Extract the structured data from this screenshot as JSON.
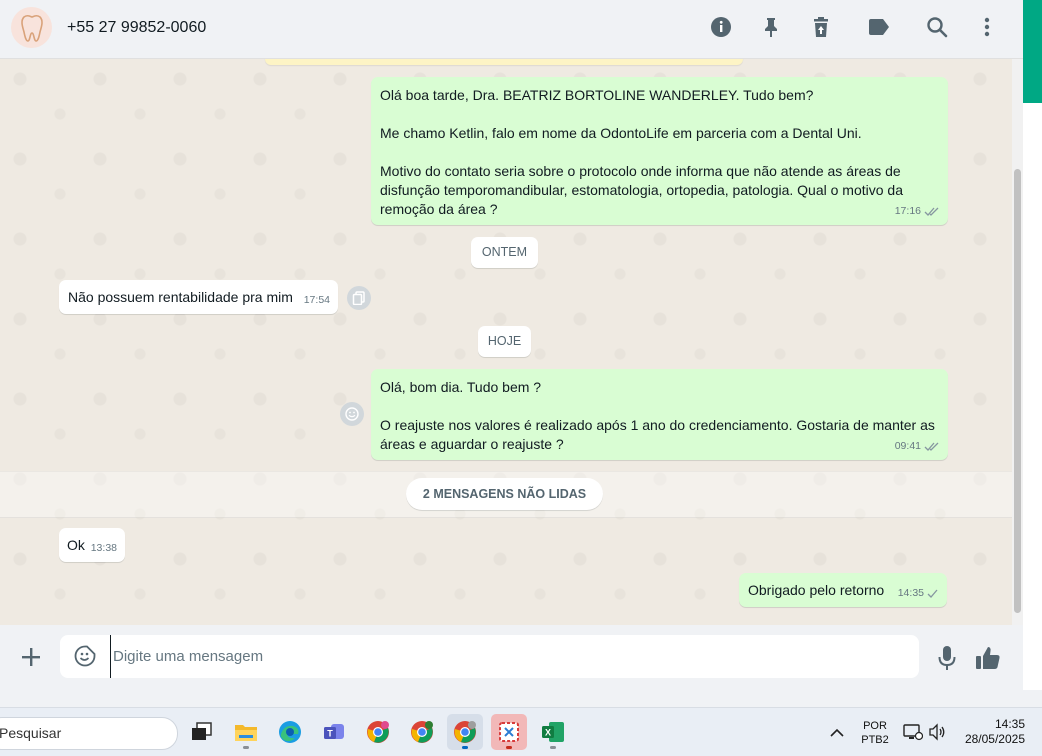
{
  "header": {
    "contact_name": "+55 27 99852-0060",
    "icons": [
      "info-icon",
      "pin-icon",
      "delete-icon",
      "label-icon",
      "search-icon",
      "menu-icon"
    ]
  },
  "messages": [
    {
      "direction": "out",
      "text": "Olá boa tarde, Dra. BEATRIZ BORTOLINE WANDERLEY. Tudo bem?\n\nMe chamo Ketlin, falo em nome da OdontoLife em parceria com a Dental Uni.\n\nMotivo do contato seria sobre o protocolo onde informa que não atende as áreas de\ndisfunção temporomandibular, estomatologia, ortopedia, patologia. Qual o motivo da\nremoção da área ?",
      "time": "17:16",
      "status": "read"
    },
    {
      "direction": "in",
      "text": "Não possuem rentabilidade pra mim",
      "time": "17:54"
    },
    {
      "direction": "out",
      "text": "Olá, bom dia. Tudo bem ?\n\nO reajuste nos valores é realizado após 1 ano do credenciamento. Gostaria de manter as\náreas e aguardar o reajuste ?",
      "time": "09:41",
      "status": "read"
    },
    {
      "direction": "in",
      "text": "Ok",
      "time": "13:38"
    },
    {
      "direction": "out",
      "text": "Obrigado pelo retorno",
      "time": "14:35",
      "status": "sent"
    }
  ],
  "date_dividers": {
    "yesterday": "ONTEM",
    "today": "HOJE"
  },
  "unread_banner": "2 MENSAGENS NÃO LIDAS",
  "composer": {
    "placeholder": "Digite uma mensagem"
  },
  "taskbar": {
    "search_text": "Pesquisar",
    "language": "POR",
    "keyboard": "PTB2",
    "clock_time": "14:35",
    "clock_date": "28/05/2025"
  },
  "colors": {
    "outgoing_bubble": "#d9fdd3",
    "incoming_bubble": "#ffffff",
    "accent": "#00a884"
  }
}
